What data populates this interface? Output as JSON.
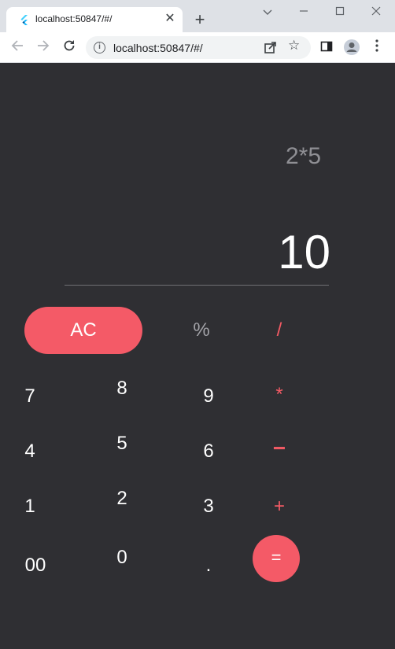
{
  "browser": {
    "tab_title": "localhost:50847/#/",
    "new_tab": "+",
    "close_tab": "✕",
    "url": "localhost:50847/#/"
  },
  "calculator": {
    "expression": "2*5",
    "result": "10",
    "accent_color": "#f45a67",
    "keys": {
      "ac": "AC",
      "percent": "%",
      "divide": "/",
      "multiply": "*",
      "minus": "−",
      "plus": "+",
      "equals": "=",
      "seven": "7",
      "eight": "8",
      "nine": "9",
      "four": "4",
      "five": "5",
      "six": "6",
      "one": "1",
      "two": "2",
      "three": "3",
      "double_zero": "00",
      "zero": "0",
      "dot": "."
    }
  }
}
